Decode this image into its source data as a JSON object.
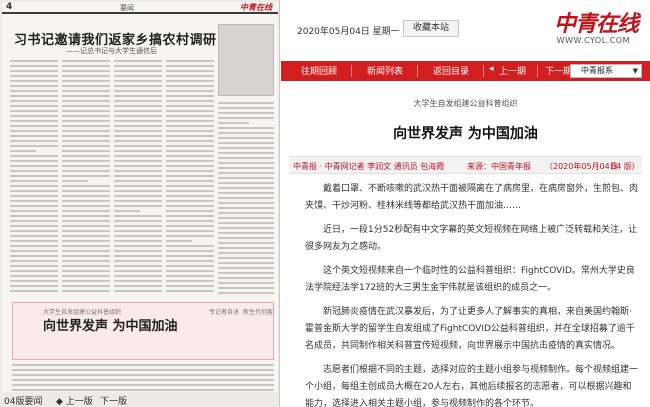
{
  "newspaper_page": {
    "page_number": "4",
    "section": "要闻",
    "logo": "中青在线",
    "headline": "习书记邀请我们返家乡搞农村调研",
    "subheadline": "——记总书记与大学生通信后",
    "highlight_kicker": "大学生自发组建公益科普组织",
    "highlight_title": "向世界发声 为中国加油",
    "highlight_side_1": "专记者自述",
    "highlight_side_2": "新生代创客"
  },
  "pager": {
    "current": "04版要闻",
    "prev": "◆ 上一版",
    "next": "下一版"
  },
  "header": {
    "date": "2020年05月04日  星期一",
    "favorite_button": "收藏本站",
    "logo": "中青在线",
    "site_url": "WWW.CYOL.COM"
  },
  "nav": {
    "items": [
      "往期回顾",
      "新闻列表",
      "返回目录",
      "上一期",
      "下一期"
    ],
    "paper_select": "中青报系"
  },
  "article": {
    "kicker": "大学生自发组建公益科普组织",
    "title": "向世界发声 为中国加油",
    "meta_source": "中青报 · 中青网记者 李润文 通讯员 包海霞",
    "meta_from": "来源：中国青年报",
    "meta_date": "（2020年05月04日",
    "meta_page": "04 版）",
    "paragraphs": [
      "戴着口罩、不断咳嗽的武汉热干面被隔离在了病房里，在病房窗外，生煎包、肉夹馍、干炒河粉、桂林米线等都给武汉热干面加油……",
      "近日，一段1分52秒配有中文字幕的英文短视频在网络上被广泛转载和关注，让很多网友为之感动。",
      "这个英文短视频来自一个临时性的公益科普组织：FightCOVID。常州大学史良法学院经法学172班的大三男生金宇伟就是该组织的成员之一。",
      "新冠肺炎疫情在武汉暴发后，为了让更多人了解事实的真相，来自美国约翰斯·霍普金斯大学的留学生自发组成了FightCOVID公益科普组织，并在全球招募了逾千名成员，共同制作相关科普宣传短视频，向世界展示中国抗击疫情的真实情况。",
      "志愿者们根据不同的主题，选择对应的主题小组参与视频制作。每个视频组建一个小组，每组主创成员大概在20人左右，其他后续报名的志愿者，可以根据兴趣和能力，选择进入相关主题小组，参与视频制作的各个环节。"
    ]
  },
  "colors": {
    "accent_red": "#d21e1e",
    "logo_red": "#c0151d",
    "highlight_pink": "#fbeaec"
  }
}
